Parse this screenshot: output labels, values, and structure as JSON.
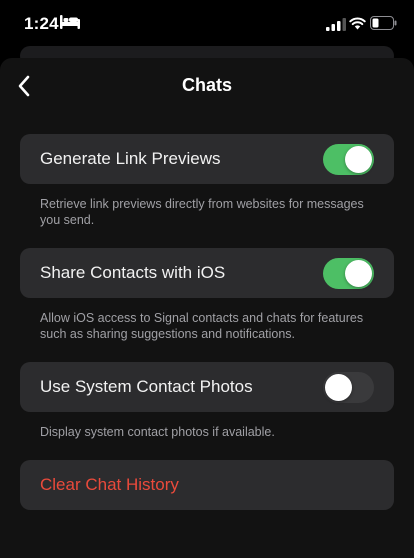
{
  "status_bar": {
    "time": "1:24",
    "icons": [
      "bed-icon",
      "cellular-signal-icon",
      "wifi-icon",
      "battery-icon"
    ]
  },
  "nav": {
    "title": "Chats",
    "back_icon": "chevron-left-icon"
  },
  "settings": [
    {
      "label": "Generate Link Previews",
      "enabled": true,
      "footer": "Retrieve link previews directly from websites for messages you send."
    },
    {
      "label": "Share Contacts with iOS",
      "enabled": true,
      "footer": "Allow iOS access to Signal contacts and chats for features such as sharing suggestions and notifications."
    },
    {
      "label": "Use System Contact Photos",
      "enabled": false,
      "footer": "Display system contact photos if available."
    }
  ],
  "clear_history": {
    "label": "Clear Chat History"
  },
  "colors": {
    "background": "#000000",
    "sheet": "#121212",
    "cell": "#2c2c2e",
    "toggle_on": "#4dbf65",
    "toggle_off": "#3a3a3c",
    "destructive": "#ea4a3b",
    "footer_text": "#a0a0a5"
  }
}
